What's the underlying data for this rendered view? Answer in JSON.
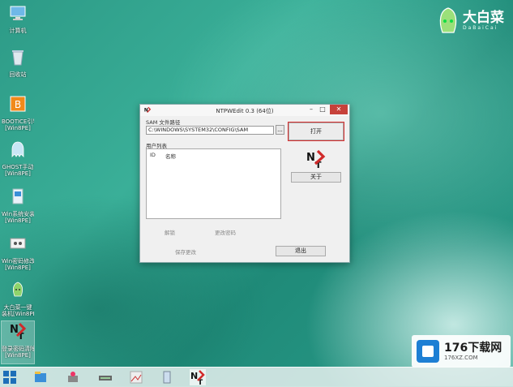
{
  "desktop": {
    "icons": [
      {
        "label": "计算机",
        "icon": "computer-icon"
      },
      {
        "label": "回收站",
        "icon": "recycle-bin-icon"
      },
      {
        "label": "BOOTICE引导",
        "icon": "bootice-icon",
        "sub": "[Win8PE]"
      },
      {
        "label": "GHOST手动",
        "icon": "ghost-icon",
        "sub": "[Win8PE]"
      },
      {
        "label": "Win系统安装",
        "icon": "windows-install-icon",
        "sub": "[Win8PE]"
      },
      {
        "label": "Win密码修改",
        "icon": "password-icon",
        "sub": "[Win8PE]"
      },
      {
        "label": "大白菜一键",
        "icon": "dabaicai-icon",
        "sub": "装机[Win8PE]"
      },
      {
        "label": "登录密码清除",
        "icon": "ntpwedit-icon",
        "sub": "[Win8PE]"
      }
    ]
  },
  "logo": {
    "name": "大白菜",
    "sub": "DaBaiCai"
  },
  "window": {
    "title": "NTPWEdit 0.3 (64位)",
    "sam_label": "SAM 文件路径",
    "sam_path": "C:\\WINDOWS\\SYSTEM32\\CONFIG\\SAM",
    "browse_label": "...",
    "open_label": "打开",
    "users_label": "用户列表",
    "col_id": "ID",
    "col_name": "名称",
    "about_label": "关于",
    "unlock_label": "解锁",
    "change_pw_label": "更改密码",
    "save_label": "保存更改",
    "exit_label": "退出"
  },
  "watermark": {
    "big": "176下载网",
    "small": "176XZ.COM"
  },
  "colors": {
    "accent_red": "#d93030",
    "desktop_teal": "#2d9b87"
  }
}
